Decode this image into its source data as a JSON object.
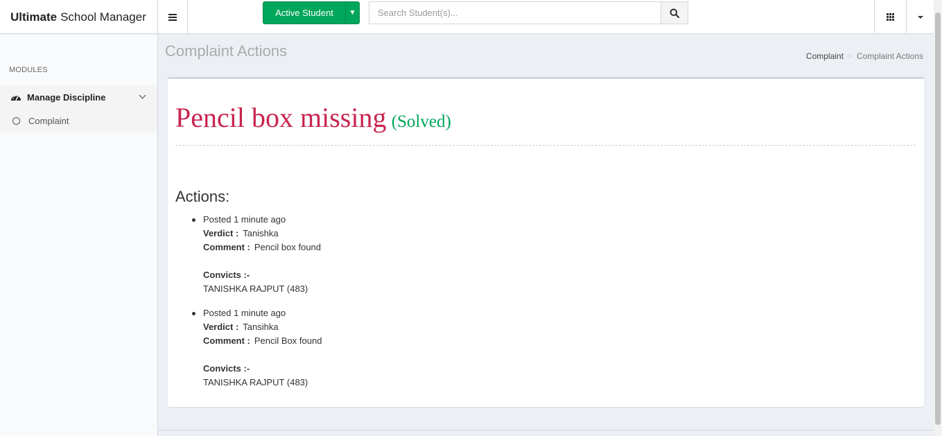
{
  "brand": {
    "bold": "Ultimate",
    "rest": "School Manager"
  },
  "header": {
    "active_student_label": "Active Student",
    "search_placeholder": "Search Student(s)..."
  },
  "sidebar": {
    "section_label": "MODULES",
    "menu": {
      "label": "Manage Discipline",
      "child": "Complaint"
    }
  },
  "page": {
    "title": "Complaint Actions",
    "breadcrumb": [
      "Complaint",
      "Complaint Actions"
    ]
  },
  "complaint": {
    "title": "Pencil box missing",
    "status": "(Solved)",
    "actions_heading": "Actions:",
    "verdict_label": "Verdict :",
    "comment_label": "Comment :",
    "convicts_label": "Convicts :-",
    "actions": [
      {
        "posted": "Posted 1 minute ago",
        "verdict": "Tanishka",
        "comment": "Pencil box found",
        "convict": "TANISHKA RAJPUT (483)"
      },
      {
        "posted": "Posted 1 minute ago",
        "verdict": "Tansihka",
        "comment": "Pencil Box found",
        "convict": "TANISHKA RAJPUT (483)"
      }
    ]
  },
  "colors": {
    "accent_green": "#00a65a",
    "title_red": "#c7254e"
  }
}
